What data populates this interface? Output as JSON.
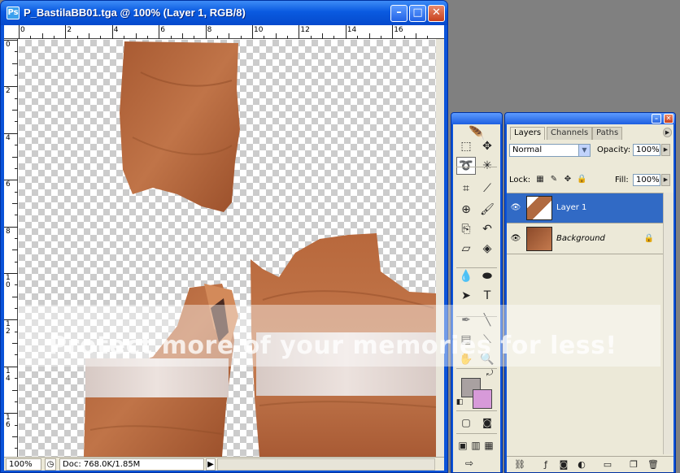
{
  "document": {
    "title": "P_BastilaBB01.tga @ 100% (Layer 1, RGB/8)",
    "app_icon": "ps-icon",
    "ruler_h": [
      "0",
      "2",
      "4",
      "6",
      "8",
      "10",
      "12",
      "14",
      "16"
    ],
    "ruler_v": [
      "0",
      "2",
      "4",
      "6",
      "8",
      "1\n0",
      "1\n2",
      "1\n4",
      "1\n6"
    ],
    "status": {
      "zoom": "100%",
      "doc_info": "Doc: 768.0K/1.85M"
    }
  },
  "tools_palette": {
    "logo_icon": "feather-icon",
    "selected_tool": "lasso-tool",
    "colors": {
      "foreground": "#a9a1a1",
      "background": "#d79ad9"
    }
  },
  "layers_palette": {
    "tabs": [
      {
        "label": "Layers",
        "active": true
      },
      {
        "label": "Channels",
        "active": false
      },
      {
        "label": "Paths",
        "active": false
      }
    ],
    "blend_mode": "Normal",
    "opacity_label": "Opacity:",
    "opacity_value": "100%",
    "lock_label": "Lock:",
    "fill_label": "Fill:",
    "fill_value": "100%",
    "layers": [
      {
        "name": "Layer 1",
        "selected": true,
        "visible": true,
        "locked": false
      },
      {
        "name": "Background",
        "selected": false,
        "visible": true,
        "locked": true
      }
    ]
  },
  "watermark": {
    "text": "Protect more of your memories for less!"
  }
}
